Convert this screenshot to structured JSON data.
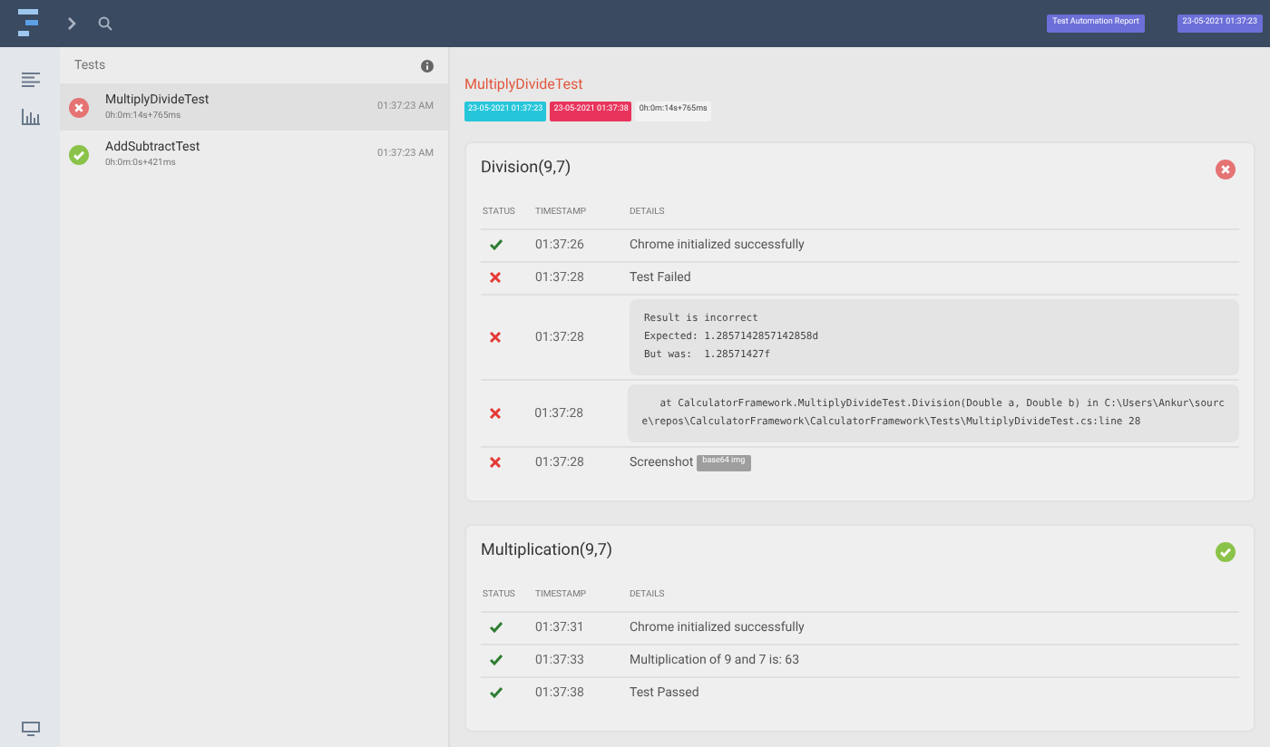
{
  "header": {
    "badges": [
      "Test Automation Report",
      "23-05-2021 01:37:23"
    ]
  },
  "tests_panel": {
    "title": "Tests",
    "items": [
      {
        "name": "MultiplyDivideTest",
        "duration": "0h:0m:14s+765ms",
        "time": "01:37:23 AM",
        "passed": false,
        "selected": true
      },
      {
        "name": "AddSubtractTest",
        "duration": "0h:0m:0s+421ms",
        "time": "01:37:23 AM",
        "passed": true,
        "selected": false
      }
    ]
  },
  "detail": {
    "title": "MultiplyDivideTest",
    "start": "23-05-2021 01:37:23",
    "end": "23-05-2021 01:37:38",
    "duration": "0h:0m:14s+765ms",
    "sections": [
      {
        "title": "Division(9,7)",
        "passed": false,
        "columns": [
          "STATUS",
          "TIMESTAMP",
          "DETAILS"
        ],
        "rows": [
          {
            "kind": "text",
            "passed": true,
            "time": "01:37:26",
            "details": "Chrome initialized successfully"
          },
          {
            "kind": "text",
            "passed": false,
            "time": "01:37:28",
            "details": "Test Failed"
          },
          {
            "kind": "code",
            "passed": false,
            "time": "01:37:28",
            "lines": [
              "Result is incorrect",
              "Expected: 1.2857142857142858d",
              "But was:  1.28571427f"
            ]
          },
          {
            "kind": "code",
            "passed": false,
            "time": "01:37:28",
            "lines": [
              "   at CalculatorFramework.MultiplyDivideTest.Division(Double a, Double b) in C:\\Users\\Ankur\\sourc",
              "e\\repos\\CalculatorFramework\\CalculatorFramework\\Tests\\MultiplyDivideTest.cs:line 28"
            ]
          },
          {
            "kind": "screenshot",
            "passed": false,
            "time": "01:37:28",
            "details": "Screenshot",
            "tag": "base64 img"
          }
        ]
      },
      {
        "title": "Multiplication(9,7)",
        "passed": true,
        "columns": [
          "STATUS",
          "TIMESTAMP",
          "DETAILS"
        ],
        "rows": [
          {
            "kind": "text",
            "passed": true,
            "time": "01:37:31",
            "details": "Chrome initialized successfully"
          },
          {
            "kind": "text",
            "passed": true,
            "time": "01:37:33",
            "details": "Multiplication of 9 and 7 is: 63"
          },
          {
            "kind": "text",
            "passed": true,
            "time": "01:37:38",
            "details": "Test Passed"
          }
        ]
      }
    ]
  }
}
